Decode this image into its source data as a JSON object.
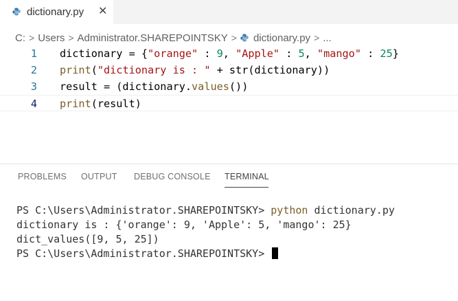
{
  "tab": {
    "label": "dictionary.py",
    "close": "✕"
  },
  "breadcrumb": [
    "C:",
    "Users",
    "Administrator.SHAREPOINTSKY",
    "dictionary.py",
    "..."
  ],
  "editor": {
    "lines": [
      {
        "number": "1"
      },
      {
        "number": "2"
      },
      {
        "number": "3"
      },
      {
        "number": "4"
      }
    ],
    "tokens": {
      "l1a": "dictionary = {",
      "l1b": "\"orange\"",
      "l1c": " : ",
      "l1d": "9",
      "l1e": ", ",
      "l1f": "\"Apple\"",
      "l1g": " : ",
      "l1h": "5",
      "l1i": ", ",
      "l1j": "\"mango\"",
      "l1k": " : ",
      "l1l": "25",
      "l1m": "}",
      "l2a": "print",
      "l2b": "(",
      "l2c": "\"dictionary is : \"",
      "l2d": " + ",
      "l2e": "str",
      "l2f": "(dictionary))",
      "l3a": "result = (dictionary.",
      "l3b": "values",
      "l3c": "())",
      "l4a": "print",
      "l4b": "(result)"
    }
  },
  "panel": {
    "tabs": [
      "PROBLEMS",
      "OUTPUT",
      "DEBUG CONSOLE",
      "TERMINAL"
    ],
    "active_tab": "TERMINAL"
  },
  "terminal": {
    "prompt1": "PS C:\\Users\\Administrator.SHAREPOINTSKY> ",
    "cmd": "python",
    "arg": " dictionary.py",
    "out1": "dictionary is : {'orange': 9, 'Apple': 5, 'mango': 25}",
    "out2": "dict_values([9, 5, 25])",
    "prompt2": "PS C:\\Users\\Administrator.SHAREPOINTSKY> "
  },
  "colors": {
    "string": "#a31515",
    "number": "#098658",
    "function": "#795e26",
    "line_number": "#237893"
  }
}
